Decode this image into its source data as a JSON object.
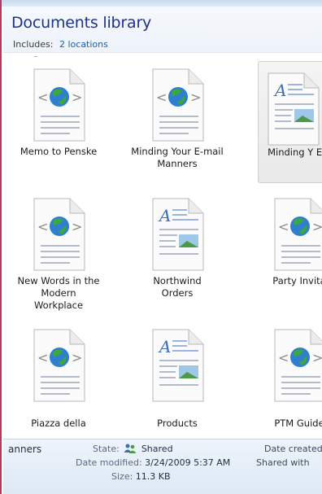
{
  "header": {
    "title": "Documents library",
    "includes_label": "Includes:",
    "includes_link": "2 locations"
  },
  "files": [
    {
      "label": "Memo to Penske",
      "icon": "html-doc-icon"
    },
    {
      "label": "Minding Your E-mail Manners",
      "icon": "html-doc-icon"
    },
    {
      "label": "Minding Y E-mail Man",
      "icon": "word-doc-icon"
    },
    {
      "label": "New Words in the Modern Workplace",
      "icon": "html-doc-icon"
    },
    {
      "label": "Northwind Orders",
      "icon": "word-doc-icon"
    },
    {
      "label": "Party Invita",
      "icon": "html-doc-icon"
    },
    {
      "label": "Piazza della",
      "icon": "html-doc-icon"
    },
    {
      "label": "Products",
      "icon": "word-doc-icon"
    },
    {
      "label": "PTM Guide",
      "icon": "html-doc-icon"
    }
  ],
  "details": {
    "name_fragment": "anners",
    "state_label": "State:",
    "state_value": "Shared",
    "date_modified_label": "Date modified:",
    "date_modified_value": "3/24/2009 5:37 AM",
    "size_label": "Size:",
    "size_value": "11.3 KB",
    "date_created_label": "Date created",
    "shared_with_label": "Shared with"
  },
  "colors": {
    "title": "#1e3287",
    "link": "#1a5fb4",
    "details_bg": "#dde8f4",
    "selected_bg": "#e9e9e9"
  }
}
